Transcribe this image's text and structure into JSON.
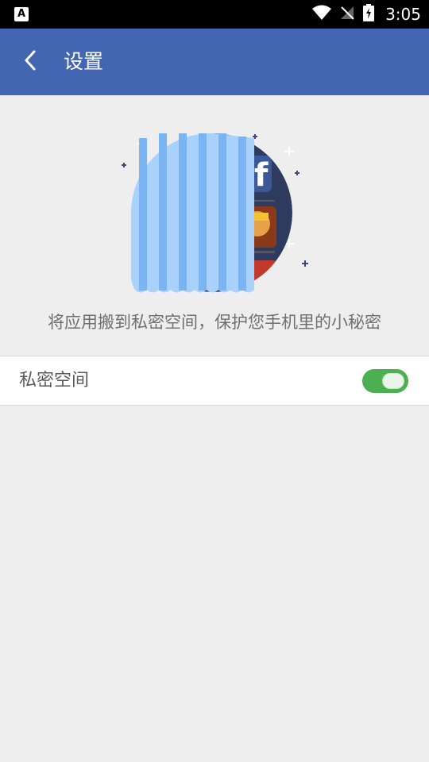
{
  "status_bar": {
    "left_icon": "A",
    "time": "3:05",
    "icons": [
      "wifi-icon",
      "signal-off-icon",
      "battery-charging-icon"
    ]
  },
  "app_bar": {
    "back_icon": "chevron-left-icon",
    "title": "设置"
  },
  "main": {
    "description": "将应用搬到私密空间，保护您手机里的小秘密",
    "setting": {
      "label": "私密空间",
      "toggle_on": true
    }
  },
  "colors": {
    "app_bar": "#4266b2",
    "toggle_on": "#4caf50",
    "background": "#eeeeee"
  }
}
